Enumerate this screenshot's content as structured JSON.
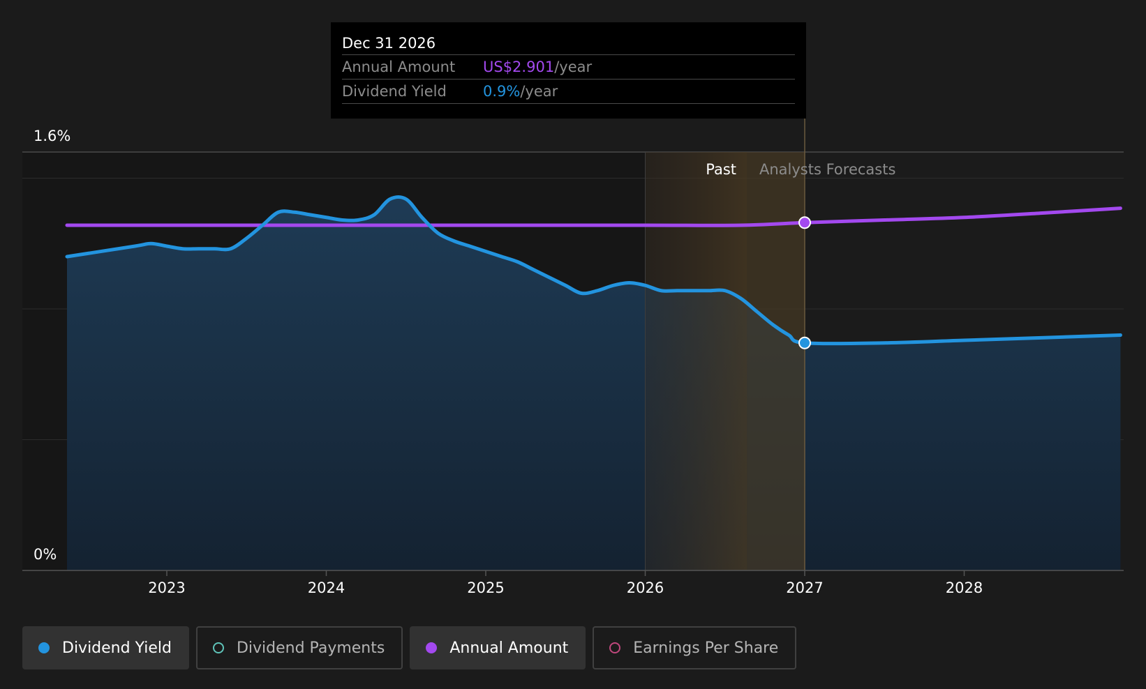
{
  "chart_data": {
    "type": "area",
    "y_axis": {
      "top_label": "1.6%",
      "bottom_label": "0%",
      "ylim": [
        0,
        1.6
      ]
    },
    "x_axis": {
      "ticks": [
        "2023",
        "2024",
        "2025",
        "2026",
        "2027",
        "2028"
      ],
      "xlim": [
        2022.37,
        2028.98
      ]
    },
    "grid": true,
    "regions": {
      "past_label": "Past",
      "forecast_label": "Analysts Forecasts",
      "past_start": 2026.0,
      "forecast_start": 2026.64,
      "divider": 2027.0
    },
    "series": [
      {
        "name": "Dividend Yield",
        "color": "#2394df",
        "x": [
          2022.65,
          2022.8,
          2022.9,
          2023.0,
          2023.1,
          2023.2,
          2023.3,
          2023.4,
          2023.5,
          2023.6,
          2023.7,
          2023.8,
          2023.9,
          2024.0,
          2024.1,
          2024.2,
          2024.3,
          2024.4,
          2024.5,
          2024.6,
          2024.7,
          2024.8,
          2024.9,
          2025.0,
          2025.1,
          2025.2,
          2025.3,
          2025.4,
          2025.5,
          2025.6,
          2025.7,
          2025.8,
          2025.9,
          2026.0,
          2026.1,
          2026.2,
          2026.3,
          2026.4,
          2026.5,
          2026.6,
          2026.7,
          2026.8,
          2026.9,
          2027.0,
          2027.5,
          2028.0,
          2028.5,
          2028.98
        ],
        "y": [
          1.2,
          1.24,
          1.25,
          1.24,
          1.23,
          1.23,
          1.23,
          1.23,
          1.27,
          1.32,
          1.37,
          1.37,
          1.36,
          1.35,
          1.34,
          1.34,
          1.36,
          1.42,
          1.42,
          1.35,
          1.29,
          1.26,
          1.24,
          1.22,
          1.2,
          1.18,
          1.15,
          1.12,
          1.09,
          1.06,
          1.07,
          1.09,
          1.1,
          1.09,
          1.07,
          1.07,
          1.07,
          1.07,
          1.07,
          1.04,
          0.99,
          0.94,
          0.9,
          0.87,
          0.87,
          0.88,
          0.89,
          0.9
        ]
      },
      {
        "name": "Annual Amount",
        "color": "#a349ef",
        "x": [
          2022.65,
          2023.0,
          2024.0,
          2025.0,
          2026.0,
          2026.6,
          2027.0,
          2027.5,
          2028.0,
          2028.5,
          2028.98
        ],
        "y": [
          1.32,
          1.32,
          1.32,
          1.32,
          1.32,
          1.32,
          1.33,
          1.34,
          1.35,
          1.367,
          1.385
        ]
      }
    ]
  },
  "tooltip": {
    "date": "Dec 31 2026",
    "annual_label": "Annual Amount",
    "annual_value": "US$2.901",
    "annual_unit": "/year",
    "yield_label": "Dividend Yield",
    "yield_value": "0.9%",
    "yield_unit": "/year"
  },
  "legend": [
    {
      "label": "Dividend Yield",
      "color": "#2394df",
      "filled": true,
      "active": true
    },
    {
      "label": "Dividend Payments",
      "color": "#5fc4b9",
      "filled": false,
      "active": false
    },
    {
      "label": "Annual Amount",
      "color": "#a349ef",
      "filled": true,
      "active": true
    },
    {
      "label": "Earnings Per Share",
      "color": "#c0487d",
      "filled": false,
      "active": false
    }
  ]
}
